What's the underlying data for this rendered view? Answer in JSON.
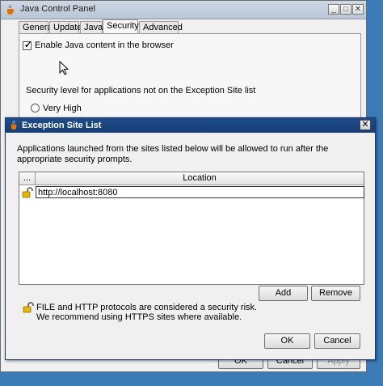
{
  "parent_window": {
    "title": "Java Control Panel",
    "controls": {
      "minimize": "_",
      "maximize": "□",
      "close": "✕"
    },
    "tabs": [
      {
        "label": "General",
        "active": false
      },
      {
        "label": "Update",
        "active": false
      },
      {
        "label": "Java",
        "active": false
      },
      {
        "label": "Security",
        "active": true
      },
      {
        "label": "Advanced",
        "active": false
      }
    ],
    "enable_java_label": "Enable Java content in the browser",
    "enable_java_checked": true,
    "security_level_label": "Security level for applications not on the Exception Site list",
    "very_high_label": "Very High",
    "buttons": {
      "ok": "OK",
      "cancel": "Cancel",
      "apply": "Apply"
    }
  },
  "dialog": {
    "title": "Exception Site List",
    "close_glyph": "✕",
    "message": "Applications launched from the sites listed below will be allowed to run after the appropriate security prompts.",
    "table": {
      "col_menu": "...",
      "col_location": "Location",
      "rows": [
        {
          "location": "http://localhost:8080",
          "icon": "unlock-icon"
        }
      ]
    },
    "add_label": "Add",
    "remove_label": "Remove",
    "warning_line1": "FILE and HTTP protocols are considered a security risk.",
    "warning_line2": "We recommend using HTTPS sites where available.",
    "ok_label": "OK",
    "cancel_label": "Cancel"
  },
  "colors": {
    "dialog_titlebar": "#1d4b8a",
    "desktop": "#3b7bb6"
  }
}
